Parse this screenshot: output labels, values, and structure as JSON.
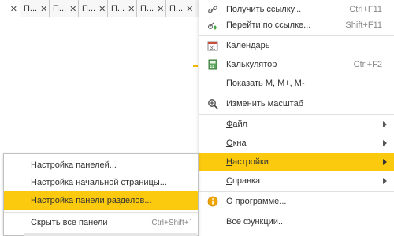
{
  "tabs": {
    "left_close": "✕",
    "items": [
      {
        "label": "П...",
        "close": "✕"
      },
      {
        "label": "П...",
        "close": "✕"
      },
      {
        "label": "П...",
        "close": "✕"
      },
      {
        "label": "П...",
        "close": "✕"
      },
      {
        "label": "П...",
        "close": "✕"
      },
      {
        "label": "П...",
        "close": "✕"
      }
    ]
  },
  "main_menu": {
    "items": [
      {
        "label": "Получить ссылку...",
        "shortcut": "Ctrl+F11",
        "icon": "link-icon"
      },
      {
        "label": "Перейти по ссылке...",
        "shortcut": "Shift+F11",
        "icon": "go-to-link-icon"
      },
      {
        "label": "Календарь",
        "icon": "calendar-icon",
        "icon_text": "31"
      },
      {
        "label": "Калькулятор",
        "underline": "К",
        "rest": "алькулятор",
        "shortcut": "Ctrl+F2",
        "icon": "calculator-icon"
      },
      {
        "label": "Показать M, M+, M-"
      },
      {
        "label": "Изменить масштаб",
        "icon": "zoom-icon"
      },
      {
        "label": "Файл",
        "underline": "Ф",
        "rest": "айл"
      },
      {
        "label": "Окна",
        "underline": "О",
        "rest": "кна"
      },
      {
        "label": "Настройки",
        "underline": "Н",
        "rest": "астройки"
      },
      {
        "label": "Справка",
        "underline": "С",
        "rest": "правка"
      },
      {
        "label": "О программе...",
        "icon": "info-icon"
      },
      {
        "label": "Все функции..."
      }
    ]
  },
  "sub_menu": {
    "items": [
      {
        "label": "Настройка панелей..."
      },
      {
        "label": "Настройка начальной страницы..."
      },
      {
        "label": "Настройка панели разделов..."
      },
      {
        "label": "Скрыть все панели",
        "shortcut": "Ctrl+Shift+`"
      }
    ]
  },
  "colors": {
    "highlight": "#fbca0f",
    "accent_line": "#f5b800"
  }
}
